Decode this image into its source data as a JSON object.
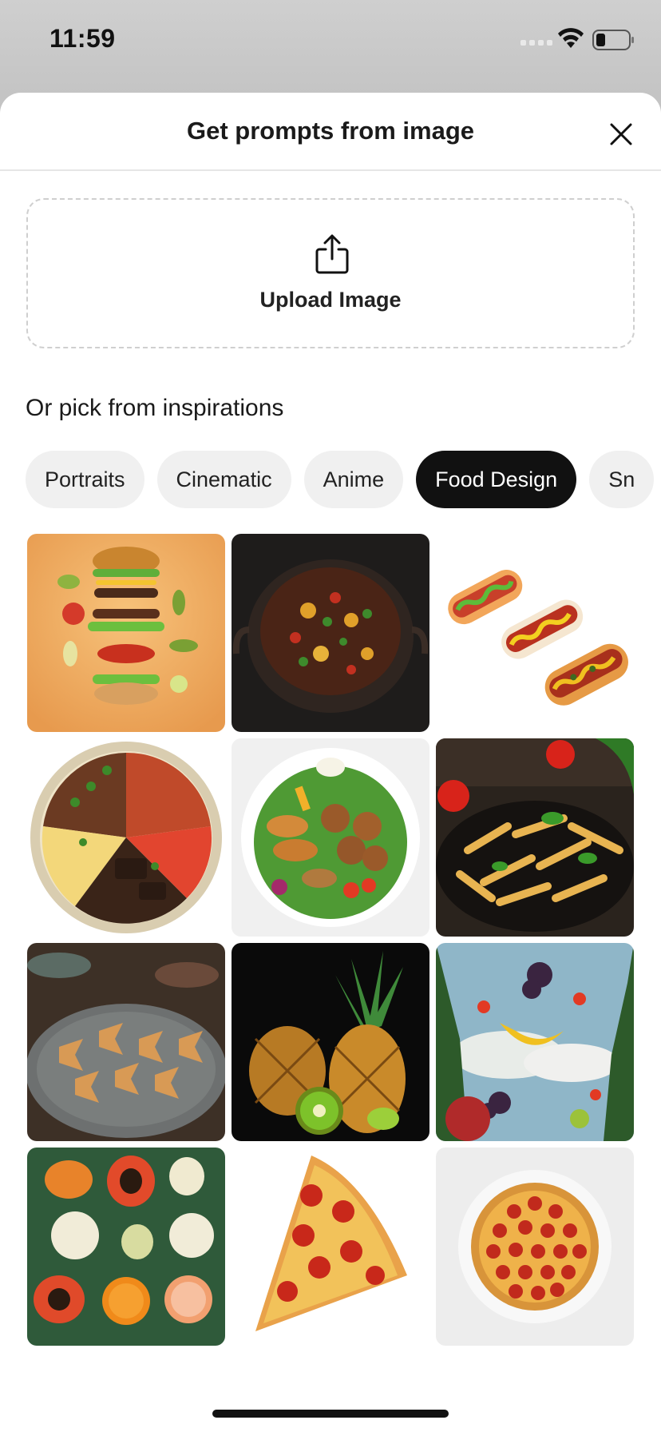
{
  "status_bar": {
    "time": "11:59",
    "icons": [
      "signal-icon",
      "wifi-icon",
      "battery-icon"
    ]
  },
  "sheet": {
    "title": "Get prompts from image",
    "close_icon": "close-icon"
  },
  "upload": {
    "label": "Upload Image",
    "icon": "share-upload-icon"
  },
  "inspirations": {
    "heading": "Or pick from inspirations",
    "categories": [
      {
        "label": "Portraits",
        "active": false
      },
      {
        "label": "Cinematic",
        "active": false
      },
      {
        "label": "Anime",
        "active": false
      },
      {
        "label": "Food Design",
        "active": true
      },
      {
        "label": "Sn",
        "active": false
      }
    ],
    "images": [
      "floating-burger-image",
      "stew-pot-image",
      "hot-dogs-image",
      "rice-beans-steak-bowl-image",
      "fried-platter-image",
      "penne-pasta-image",
      "farfalle-pasta-image",
      "pineapple-kiwi-image",
      "fruit-sky-image",
      "cut-fruits-image",
      "pizza-slice-image",
      "pepperoni-pizza-image"
    ]
  },
  "colors": {
    "accent_chip": "#111111",
    "chip_bg": "#f0f0f0",
    "sheet_bg": "#ffffff"
  }
}
